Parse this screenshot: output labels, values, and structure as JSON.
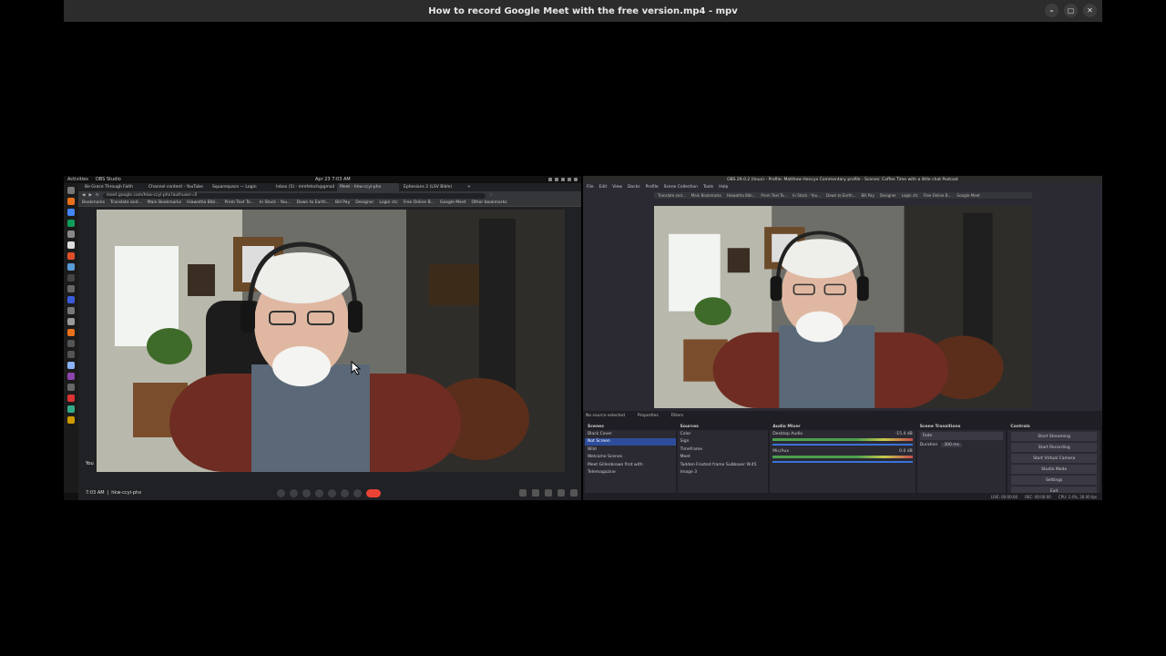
{
  "mpv": {
    "title": "How to record Google Meet with the free version.mp4 - mpv",
    "buttons": {
      "minimize": "–",
      "maximize": "▢",
      "close": "✕"
    }
  },
  "gnome": {
    "activities": "Activities",
    "app": "OBS Studio",
    "clock": "Apr 23  7:03 AM"
  },
  "browser": {
    "tabs": [
      "Be Grace Through Faith",
      "Channel content - YouTube",
      "Squarespace — Login",
      "Inbox (5) - mmfetsch@gmail",
      "Meet - hkw-ccyi-phx",
      "Ephesians 2 (LSV Bible)"
    ],
    "url": "meet.google.com/hkw-ccyi-phx?authuser=0",
    "bookmarks": [
      "Bookmarks",
      "Translate and...",
      "Main Bookmarks",
      "Hiawatha Bibl...",
      "Prom Text To...",
      "In Stock - You...",
      "Down to Earth...",
      "Bill Pay",
      "Designer",
      "Login ctc",
      "Free Online B...",
      "Google Meet",
      "Other bookmarks"
    ]
  },
  "meet": {
    "time": "7:03 AM",
    "meeting_code": "hkw-ccyi-phx",
    "self_label": "You"
  },
  "obs": {
    "title": "OBS 29.0.2 (linux) - Profile: Matthew Hencyx Commentary profile - Scenes: Coffee Time with a little chat Podcast",
    "menu": [
      "File",
      "Edit",
      "View",
      "Docks",
      "Profile",
      "Scene Collection",
      "Tools",
      "Help"
    ],
    "no_source": "No source selected",
    "properties": "Properties",
    "filters": "Filters",
    "docks": {
      "scenes": {
        "title": "Scenes",
        "items": [
          "Black Cover",
          "Not Screen",
          "Wild",
          "Welcome Scenes",
          "Meet Gillenbrown first with",
          "Telemagazine"
        ],
        "selected_index": 1
      },
      "sources": {
        "title": "Sources",
        "items": [
          "Color",
          "Sign",
          "Timeframe",
          "Meet",
          "Tadden Frosted frame Subboxer W.45",
          "Image 3"
        ]
      },
      "mixer": {
        "title": "Audio Mixer",
        "tracks": [
          {
            "name": "Desktop Audio",
            "db": "-15.4 dB"
          },
          {
            "name": "Mic/Aux",
            "db": "0.0 dB"
          }
        ]
      },
      "transitions": {
        "title": "Scene Transitions",
        "type": "Fade",
        "duration_label": "Duration",
        "duration": "300 ms"
      },
      "controls": {
        "title": "Controls",
        "buttons": [
          "Start Streaming",
          "Start Recording",
          "Start Virtual Camera",
          "Studio Mode",
          "Settings",
          "Exit"
        ]
      }
    },
    "status": {
      "live": "LIVE: 00:00:00",
      "rec": "REC: 00:00:00",
      "cpu": "CPU: 2.4%, 30.00 fps"
    }
  },
  "colors": {
    "end_call": "#ea4335",
    "selected_scene": "#2d4d9c"
  }
}
